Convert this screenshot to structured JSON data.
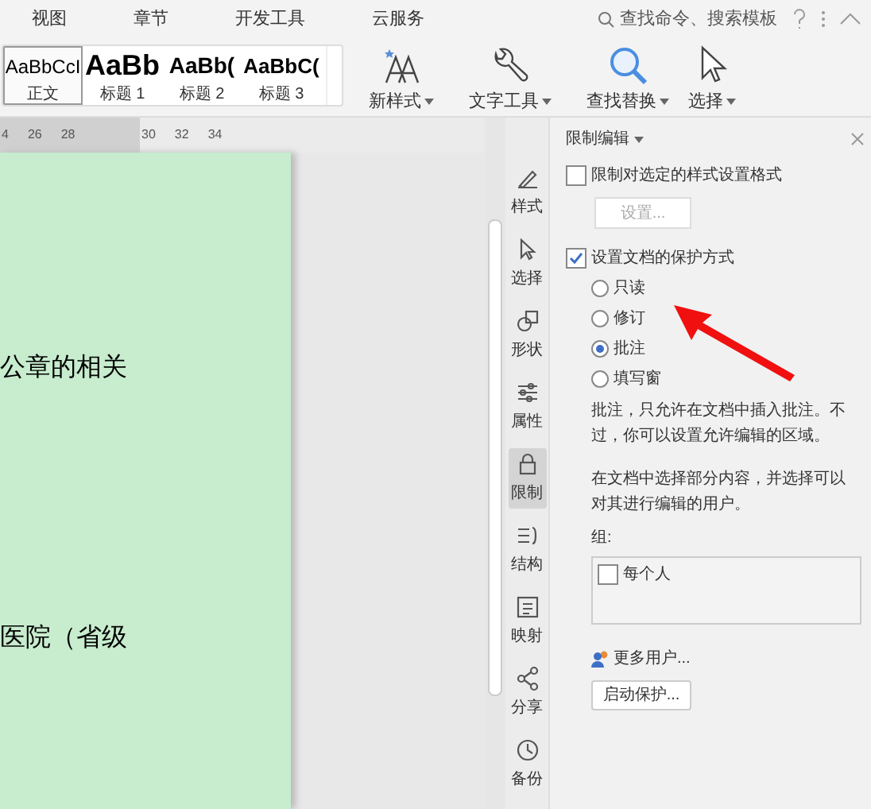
{
  "menu_tabs": [
    {
      "label": "视图",
      "selected": false
    },
    {
      "label": "章节",
      "selected": false
    },
    {
      "label": "开发工具",
      "selected": false
    },
    {
      "label": "云服务",
      "selected": false
    }
  ],
  "search": {
    "placeholder": "查找命令、搜索模板"
  },
  "styles": [
    {
      "sample": "AaBbCcI",
      "label": "正文",
      "selected": true,
      "kind": "normal"
    },
    {
      "sample": "AaBb",
      "label": "标题 1",
      "selected": false,
      "kind": "h1"
    },
    {
      "sample": "AaBb(",
      "label": "标题 2",
      "selected": false,
      "kind": "h2"
    },
    {
      "sample": "AaBbC(",
      "label": "标题 3",
      "selected": false,
      "kind": "h3"
    }
  ],
  "ribbon_tools": [
    {
      "label": "新样式",
      "kind": "newstyle"
    },
    {
      "label": "文字工具",
      "kind": "wrench"
    },
    {
      "label": "查找替换",
      "kind": "search"
    },
    {
      "label": "选择",
      "kind": "cursor"
    }
  ],
  "ruler": [
    "4",
    "26",
    "28",
    "30",
    "32",
    "34"
  ],
  "document": {
    "lines": [
      "公章的相关",
      "医院（省级"
    ]
  },
  "side_tools": [
    {
      "label": "样式",
      "kind": "pen",
      "selected": false
    },
    {
      "label": "选择",
      "kind": "cursor",
      "selected": false
    },
    {
      "label": "形状",
      "kind": "shape",
      "selected": false
    },
    {
      "label": "属性",
      "kind": "sliders",
      "selected": false
    },
    {
      "label": "限制",
      "kind": "lock",
      "selected": true
    },
    {
      "label": "结构",
      "kind": "list",
      "selected": false
    },
    {
      "label": "映射",
      "kind": "map",
      "selected": false
    },
    {
      "label": "分享",
      "kind": "share",
      "selected": false
    },
    {
      "label": "备份",
      "kind": "history",
      "selected": false
    }
  ],
  "panel": {
    "title": "限制编辑",
    "format_limit": {
      "label": "限制对选定的样式设置格式",
      "checked": false
    },
    "settings_button": "设置...",
    "protect": {
      "label": "设置文档的保护方式",
      "checked": true
    },
    "modes": [
      {
        "label": "只读",
        "selected": false
      },
      {
        "label": "修订",
        "selected": false
      },
      {
        "label": "批注",
        "selected": true
      },
      {
        "label": "填写窗",
        "selected": false
      }
    ],
    "description": "批注，只允许在文档中插入批注。不过，你可以设置允许编辑的区域。",
    "hint": "在文档中选择部分内容，并选择可以对其进行编辑的用户。",
    "group_label": "组:",
    "groups": [
      {
        "label": "每个人",
        "checked": false
      }
    ],
    "more_users": "更多用户...",
    "start_button": "启动保护..."
  }
}
